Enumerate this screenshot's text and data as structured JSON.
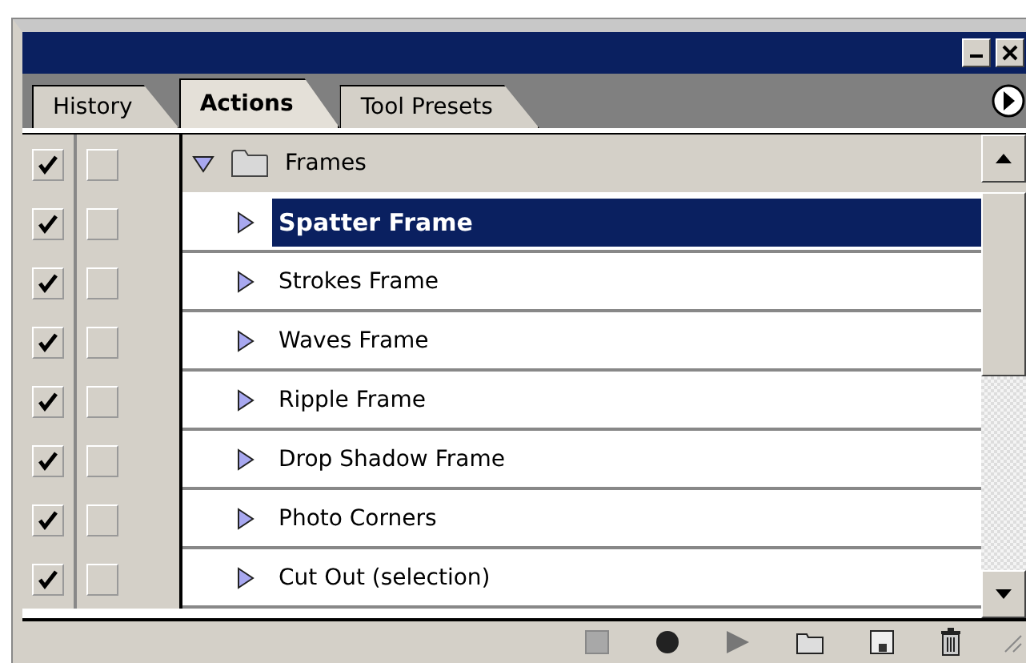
{
  "tabs": [
    {
      "label": "History",
      "selected": false
    },
    {
      "label": "Actions",
      "selected": true
    },
    {
      "label": "Tool Presets",
      "selected": false
    }
  ],
  "set": {
    "name": "Frames",
    "expanded": true,
    "checked": true,
    "dialog": false
  },
  "actions": [
    {
      "name": "Spatter Frame",
      "checked": true,
      "dialog": false,
      "expanded": false,
      "selected": true
    },
    {
      "name": "Strokes Frame",
      "checked": true,
      "dialog": false,
      "expanded": false,
      "selected": false
    },
    {
      "name": "Waves Frame",
      "checked": true,
      "dialog": false,
      "expanded": false,
      "selected": false
    },
    {
      "name": "Ripple Frame",
      "checked": true,
      "dialog": false,
      "expanded": false,
      "selected": false
    },
    {
      "name": "Drop Shadow Frame",
      "checked": true,
      "dialog": false,
      "expanded": false,
      "selected": false
    },
    {
      "name": "Photo Corners",
      "checked": true,
      "dialog": false,
      "expanded": false,
      "selected": false
    },
    {
      "name": "Cut Out (selection)",
      "checked": true,
      "dialog": false,
      "expanded": false,
      "selected": false
    }
  ]
}
